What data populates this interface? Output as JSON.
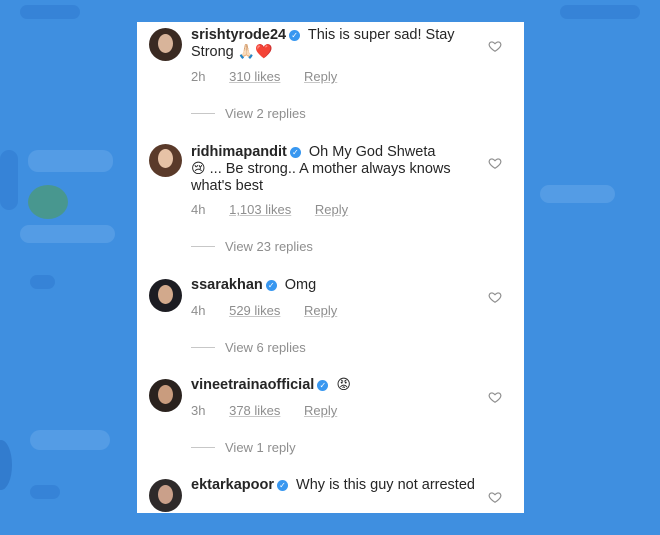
{
  "comments": [
    {
      "username": "srishtyrode24",
      "text": "This is super sad! Stay Strong",
      "emoji": "🙏🏻❤️",
      "time": "2h",
      "likes": "310 likes",
      "reply_label": "Reply",
      "view_replies": "View 2 replies",
      "avatar_colors": {
        "hair": "#3a2a22",
        "skin": "#d8b49a"
      }
    },
    {
      "username": "ridhimapandit",
      "text_before": "Oh My God Shweta",
      "emoji": "😢",
      "text": "... Be strong.. A mother always knows what's best",
      "time": "4h",
      "likes": "1,103 likes",
      "reply_label": "Reply",
      "view_replies": "View 23 replies",
      "avatar_colors": {
        "hair": "#5a3a2a",
        "skin": "#e6c2a6"
      }
    },
    {
      "username": "ssarakhan",
      "text": "Omg",
      "time": "4h",
      "likes": "529 likes",
      "reply_label": "Reply",
      "view_replies": "View 6 replies",
      "avatar_colors": {
        "hair": "#1c1c22",
        "skin": "#d2a98c"
      }
    },
    {
      "username": "vineetrainaofficial",
      "emoji": "😡",
      "time": "3h",
      "likes": "378 likes",
      "reply_label": "Reply",
      "view_replies": "View 1 reply",
      "avatar_colors": {
        "hair": "#2a221e",
        "skin": "#c99c7e"
      }
    },
    {
      "username": "ektarkapoor",
      "text": "Why is this guy not arrested",
      "avatar_colors": {
        "hair": "#2e2a2a",
        "skin": "#caa08a"
      }
    }
  ],
  "colors": {
    "background": "#3f8fe0",
    "verified": "#3897f0",
    "meta_text": "#8e8e8e",
    "body_text": "#262626"
  },
  "icons": {
    "verified": "verified-badge-icon",
    "like": "heart-outline-icon"
  }
}
